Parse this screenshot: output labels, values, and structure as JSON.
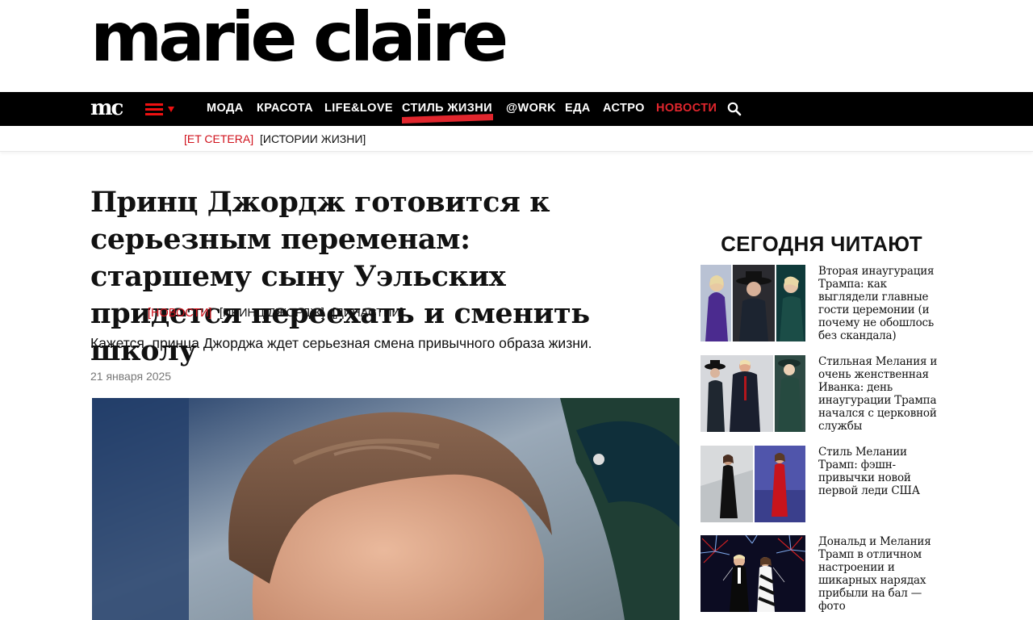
{
  "brand": {
    "logo": "marie claire",
    "short_logo": "mc"
  },
  "nav": {
    "items": [
      {
        "label": "МОДА",
        "active": false
      },
      {
        "label": "КРАСОТА",
        "active": false
      },
      {
        "label": "LIFE&LOVE",
        "active": false
      },
      {
        "label": "СТИЛЬ ЖИЗНИ",
        "active": true
      },
      {
        "label": "@WORK",
        "active": false
      },
      {
        "label": "ЕДА",
        "active": false
      },
      {
        "label": "АСТРО",
        "active": false
      },
      {
        "label": "НОВОСТИ",
        "active": false
      }
    ],
    "accent_color": "#e1262d"
  },
  "subnav": {
    "items": [
      {
        "label": "[ET CETERA]"
      },
      {
        "label": "[ИСТОРИИ ЖИЗНИ]"
      }
    ]
  },
  "article": {
    "title": "Принц Джордж готовится к серьезным переменам: старшему сыну Уэльских придется переехать и сменить школу",
    "tags": [
      "[НОВОСТИ]",
      "[ПРИНЦ ДЖОРДЖ]",
      "[ДИНАСТИИ]"
    ],
    "lead": "Кажется, принца Джорджа ждет серьезная смена привычного образа жизни.",
    "date": "21 января 2025"
  },
  "sidebar": {
    "title": "СЕГОДНЯ ЧИТАЮТ",
    "cards": [
      {
        "title": "Вторая инаугурация Трампа: как выглядели главные гости церемонии (и почему не обошлось без скандала)"
      },
      {
        "title": "Стильная Мелания и очень женственная Иванка: день инаугурации Трампа начался с церковной службы"
      },
      {
        "title": "Стиль Мелании Трамп: фэшн-привычки новой первой леди США"
      },
      {
        "title": "Дональд и Мелания Трамп в отличном настроении и шикарных нарядах прибыли на бал — фото"
      }
    ]
  }
}
